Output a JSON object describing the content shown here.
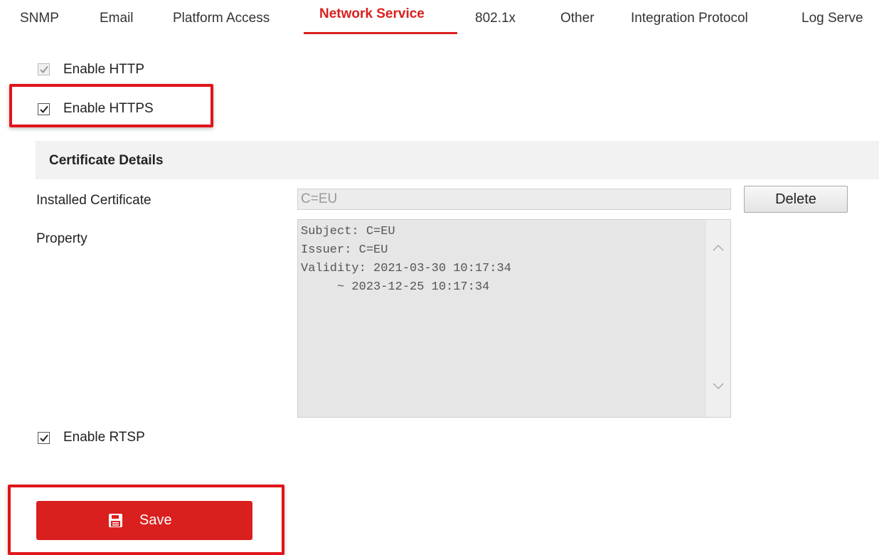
{
  "tabs": [
    {
      "label": "SNMP"
    },
    {
      "label": "Email"
    },
    {
      "label": "Platform Access"
    },
    {
      "label": "Network Service"
    },
    {
      "label": "802.1x"
    },
    {
      "label": "Other"
    },
    {
      "label": "Integration Protocol"
    },
    {
      "label": "Log Serve"
    }
  ],
  "active_tab": "Network Service",
  "checkboxes": {
    "http": {
      "label": "Enable HTTP",
      "checked": true,
      "disabled": true
    },
    "https": {
      "label": "Enable HTTPS",
      "checked": true,
      "disabled": false
    },
    "rtsp": {
      "label": "Enable RTSP",
      "checked": true,
      "disabled": false
    }
  },
  "certificate": {
    "section_title": "Certificate Details",
    "installed_label": "Installed Certificate",
    "installed_value": "C=EU",
    "delete_label": "Delete",
    "property_label": "Property",
    "property_lines": [
      "Subject: C=EU",
      "Issuer: C=EU",
      "Validity: 2021-03-30 10:17:34",
      "     ~ 2023-12-25 10:17:34"
    ]
  },
  "save": {
    "label": "Save",
    "icon": "save-icon"
  },
  "colors": {
    "accent": "#d9201f",
    "highlight": "#e0141a",
    "section_band": "#f2f2f2"
  }
}
